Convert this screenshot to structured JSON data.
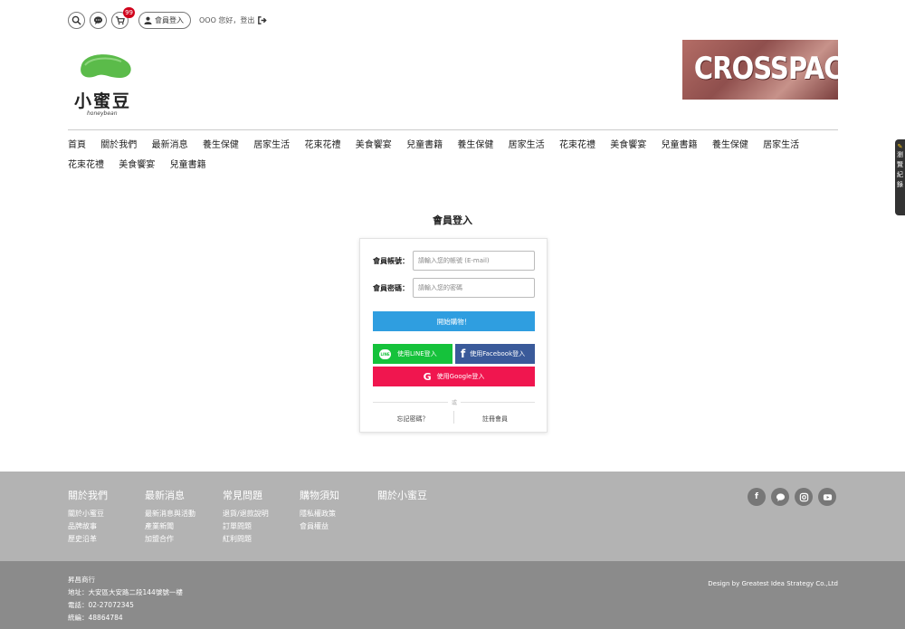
{
  "header": {
    "cart_count": "99",
    "member_login_label": "會員登入",
    "greeting": "OOO 您好，登出"
  },
  "logo": {
    "name": "小蜜豆",
    "subtitle": "honeybean"
  },
  "banner": {
    "text": "CROSSPACE"
  },
  "nav": {
    "items": [
      "首頁",
      "關於我們",
      "最新消息",
      "養生保健",
      "居家生活",
      "花束花禮",
      "美食饗宴",
      "兒童書籍",
      "養生保健",
      "居家生活",
      "花束花禮",
      "美食饗宴",
      "兒童書籍",
      "養生保健",
      "居家生活",
      "花束花禮",
      "美食饗宴",
      "兒童書籍"
    ]
  },
  "side_tab": {
    "label": "瀏覽紀錄"
  },
  "login": {
    "title": "會員登入",
    "account_label": "會員帳號：",
    "account_placeholder": "請輸入您的帳號 (E-mail)",
    "password_label": "會員密碼：",
    "password_placeholder": "請輸入您的密碼",
    "submit_label": "開始購物！",
    "line_label": "使用LINE登入",
    "line_icon_text": "LINE",
    "facebook_label": "使用Facebook登入",
    "google_label": "使用Google登入",
    "or_text": "或",
    "forgot_label": "忘記密碼？",
    "register_label": "註冊會員"
  },
  "footer": {
    "columns": [
      {
        "title": "關於我們",
        "links": [
          "關於小蜜豆",
          "品牌故事",
          "歷史沿革"
        ]
      },
      {
        "title": "最新消息",
        "links": [
          "最新消息與活動",
          "產業新聞",
          "加盟合作"
        ]
      },
      {
        "title": "常見問題",
        "links": [
          "退貨/退款說明",
          "訂單問題",
          "紅利問題"
        ]
      },
      {
        "title": "購物須知",
        "links": [
          "隱私權政策",
          "會員權益"
        ]
      },
      {
        "title": "關於小蜜豆",
        "links": []
      }
    ],
    "company": "昇昌商行",
    "address": "地址：大安區大安路二段144號號一樓",
    "phone": "電話：02-27072345",
    "tax_id": "統編：48864784",
    "design_credit": "Design by Greatest Idea Strategy Co.,Ltd"
  },
  "colors": {
    "login_button": "#2f9ee0",
    "line": "#15c23b",
    "facebook": "#3a5a9a",
    "google": "#f0164f",
    "cart_badge": "#d0021b",
    "footer_top": "#b3b3b3",
    "footer_bottom": "#8b8b8b"
  }
}
